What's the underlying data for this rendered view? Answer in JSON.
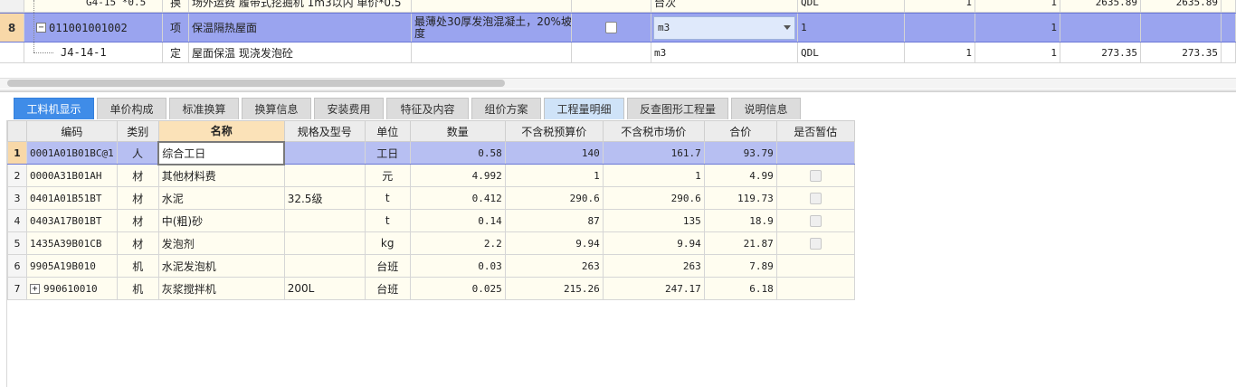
{
  "upper_grid": {
    "prev_row": {
      "code": "G4-15 *0.5",
      "type": "换",
      "name": "场外运费 履带式挖掘机 1m3以内  单价*0.5",
      "unit": "台次",
      "qty_expr": "QDL",
      "v1": "1",
      "v2": "1",
      "price": "2635.89",
      "total": "2635.89"
    },
    "selected_row": {
      "num": "8",
      "toggle": "−",
      "code": "011001001002",
      "type": "项",
      "name": "保温隔热屋面",
      "feature_line1": "最薄处30厚发泡混凝土，20%坡",
      "feature_line2": "度",
      "unit": "m3",
      "qty_expr": "1",
      "v2": "1"
    },
    "child_row": {
      "code": "J4-14-1",
      "type": "定",
      "name": "屋面保温 现浇发泡砼",
      "unit": "m3",
      "qty_expr": "QDL",
      "v1": "1",
      "v2": "1",
      "price": "273.35",
      "total": "273.35"
    }
  },
  "tabs": [
    {
      "label": "工料机显示"
    },
    {
      "label": "单价构成"
    },
    {
      "label": "标准换算"
    },
    {
      "label": "换算信息"
    },
    {
      "label": "安装费用"
    },
    {
      "label": "特征及内容"
    },
    {
      "label": "组价方案"
    },
    {
      "label": "工程量明细"
    },
    {
      "label": "反查图形工程量"
    },
    {
      "label": "说明信息"
    }
  ],
  "lower_grid": {
    "headers": {
      "code": "编码",
      "category": "类别",
      "name": "名称",
      "spec": "规格及型号",
      "unit": "单位",
      "qty": "数量",
      "budget_price": "不含税预算价",
      "market_price": "不含税市场价",
      "total": "合价",
      "provisional": "是否暂估"
    },
    "rows": [
      {
        "num": "1",
        "code": "0001A01B01BC@1",
        "category": "人",
        "name": "综合工日",
        "spec": "",
        "unit": "工日",
        "qty": "0.58",
        "budget_price": "140",
        "market_price": "161.7",
        "total": "93.79"
      },
      {
        "num": "2",
        "code": "0000A31B01AH",
        "category": "材",
        "name": "其他材料费",
        "spec": "",
        "unit": "元",
        "qty": "4.992",
        "budget_price": "1",
        "market_price": "1",
        "total": "4.99"
      },
      {
        "num": "3",
        "code": "0401A01B51BT",
        "category": "材",
        "name": "水泥",
        "spec": "32.5级",
        "unit": "t",
        "qty": "0.412",
        "budget_price": "290.6",
        "market_price": "290.6",
        "total": "119.73"
      },
      {
        "num": "4",
        "code": "0403A17B01BT",
        "category": "材",
        "name": "中(粗)砂",
        "spec": "",
        "unit": "t",
        "qty": "0.14",
        "budget_price": "87",
        "market_price": "135",
        "total": "18.9"
      },
      {
        "num": "5",
        "code": "1435A39B01CB",
        "category": "材",
        "name": "发泡剂",
        "spec": "",
        "unit": "kg",
        "qty": "2.2",
        "budget_price": "9.94",
        "market_price": "9.94",
        "total": "21.87"
      },
      {
        "num": "6",
        "code": "9905A19B010",
        "category": "机",
        "name": "水泥发泡机",
        "spec": "",
        "unit": "台班",
        "qty": "0.03",
        "budget_price": "263",
        "market_price": "263",
        "total": "7.89"
      },
      {
        "num": "7",
        "code": "990610010",
        "category": "机",
        "name": "灰浆搅拌机",
        "spec": "200L",
        "unit": "台班",
        "qty": "0.025",
        "budget_price": "215.26",
        "market_price": "247.17",
        "total": "6.18",
        "expand": "+"
      }
    ]
  }
}
